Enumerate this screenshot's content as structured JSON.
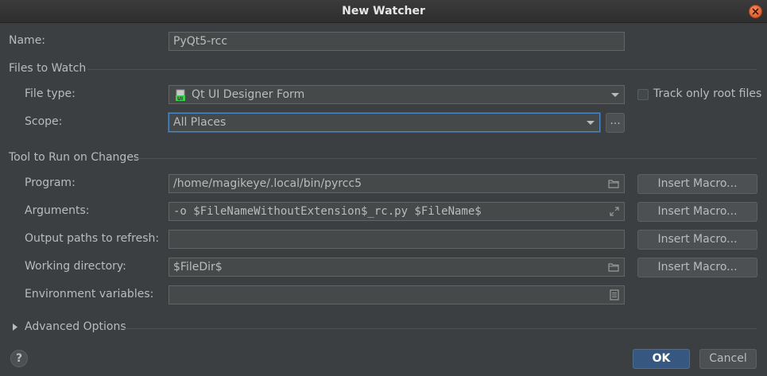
{
  "window": {
    "title": "New Watcher"
  },
  "name": {
    "label": "Name:",
    "value": "PyQt5-rcc"
  },
  "files_to_watch": {
    "section_title": "Files to Watch",
    "file_type": {
      "label": "File type:",
      "value": "Qt UI Designer Form",
      "icon": "qt-ui-file-icon"
    },
    "track_only_root_files": {
      "label": "Track only root files",
      "checked": false
    },
    "scope": {
      "label": "Scope:",
      "value": "All Places",
      "browse_label": "..."
    }
  },
  "tool_to_run": {
    "section_title": "Tool to Run on Changes",
    "program": {
      "label": "Program:",
      "value": "/home/magikeye/.local/bin/pyrcc5",
      "icon": "folder-icon"
    },
    "arguments": {
      "label": "Arguments:",
      "value": "-o $FileNameWithoutExtension$_rc.py $FileName$",
      "icon": "expand-icon"
    },
    "output_paths": {
      "label": "Output paths to refresh:",
      "value": ""
    },
    "working_directory": {
      "label": "Working directory:",
      "value": "$FileDir$",
      "icon": "folder-icon"
    },
    "environment_variables": {
      "label": "Environment variables:",
      "value": "",
      "icon": "document-icon"
    },
    "insert_macro_label": "Insert Macro..."
  },
  "advanced_options": {
    "label": "Advanced Options"
  },
  "footer": {
    "help": "?",
    "ok": "OK",
    "cancel": "Cancel"
  }
}
